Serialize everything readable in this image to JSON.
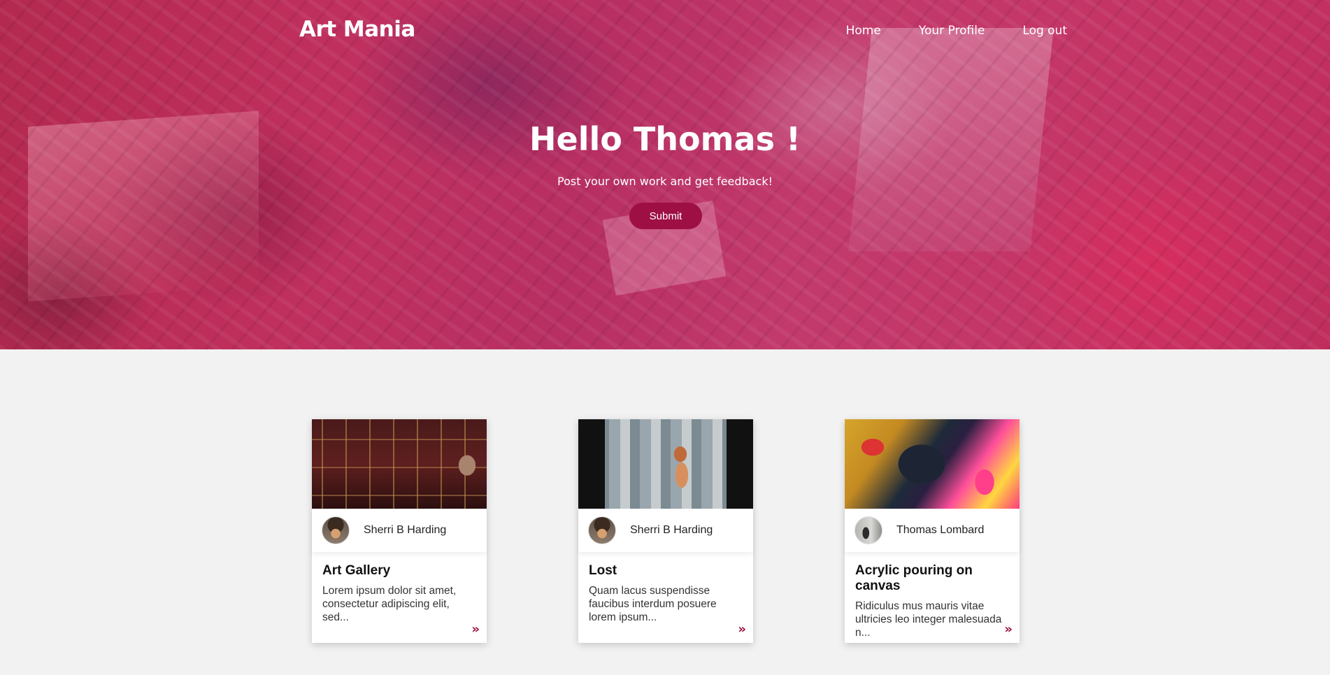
{
  "header": {
    "logo": "Art Mania",
    "nav": [
      {
        "label": "Home"
      },
      {
        "label": "Your Profile"
      },
      {
        "label": "Log out"
      }
    ]
  },
  "hero": {
    "title": "Hello Thomas !",
    "subtitle": "Post your own work and get feedback!",
    "button_label": "Submit"
  },
  "cards": [
    {
      "image": "art-gallery-photo",
      "author": "Sherri B Harding",
      "title": "Art Gallery",
      "text": "Lorem ipsum dolor sit amet, consectetur adipiscing elit, sed..."
    },
    {
      "image": "city-window-photo",
      "author": "Sherri B Harding",
      "title": "Lost",
      "text": "Quam lacus suspendisse faucibus interdum posuere lorem ipsum..."
    },
    {
      "image": "acrylic-pour-photo",
      "author": "Thomas Lombard",
      "title": "Acrylic pouring on canvas",
      "text": "Ridiculus mus mauris vitae ultricies leo integer malesuada n..."
    }
  ],
  "colors": {
    "accent": "#9e0f44",
    "hero_overlay": "#c0305f",
    "page_background": "#f2f2f2"
  },
  "icons": {
    "read_more": "double-chevron-right-icon"
  }
}
